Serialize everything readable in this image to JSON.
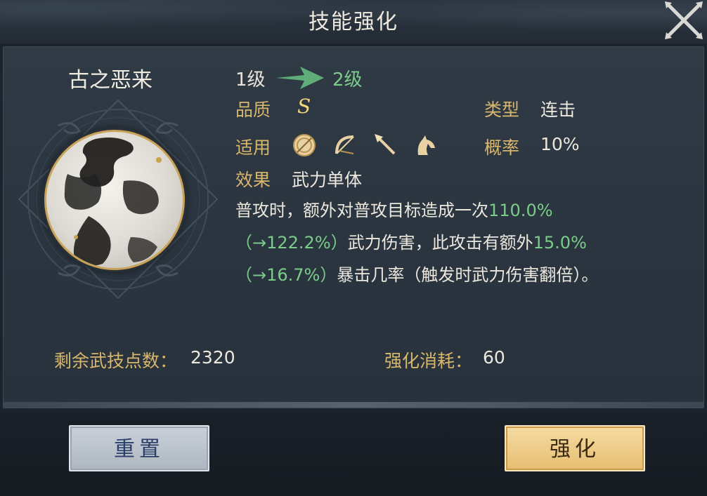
{
  "header": {
    "title": "技能强化"
  },
  "skill": {
    "name": "古之恶来",
    "level_from": "1级",
    "level_to": "2级",
    "quality_label": "品质",
    "quality_value": "S",
    "type_label": "类型",
    "type_value": "连击",
    "applicable_label": "适用",
    "applicable_icons": [
      "shield-icon",
      "bow-icon",
      "spear-icon",
      "horse-icon"
    ],
    "chance_label": "概率",
    "chance_value": "10%",
    "effect_label": "效果",
    "effect_value": "武力单体",
    "description": {
      "p1": "普攻时，额外对普攻目标造成一次",
      "p1_hl": "110.0%",
      "p2_hl": "（→122.2%）",
      "p2": "武力伤害，此攻击有额外",
      "p2_hl2": "15.0%",
      "p3_hl": "（→16.7%）",
      "p3": "暴击几率（触发时武力伤害翻倍）。"
    }
  },
  "footer": {
    "points_label": "剩余武技点数：",
    "points_value": "2320",
    "cost_label": "强化消耗：",
    "cost_value": "60"
  },
  "buttons": {
    "reset": "重置",
    "upgrade": "强化"
  },
  "colors": {
    "highlight": "#7bcc8a",
    "label_gold": "#d8b66c",
    "panel": "#2b3540"
  }
}
